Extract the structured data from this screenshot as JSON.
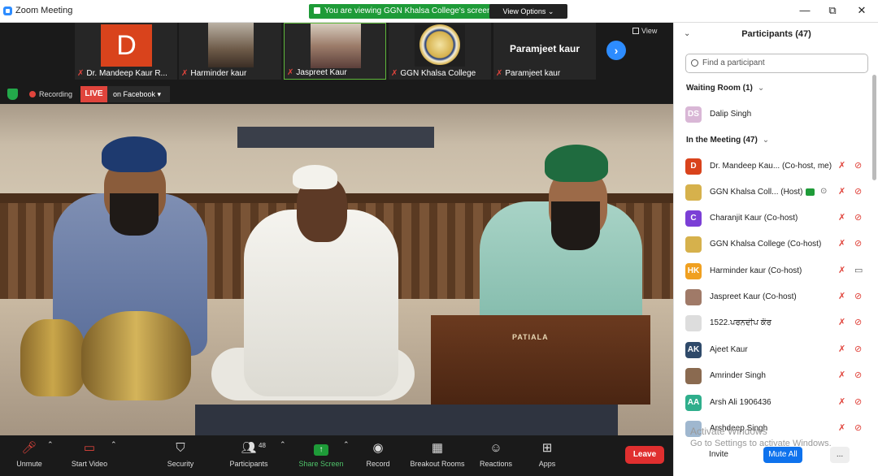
{
  "window": {
    "title": "Zoom Meeting",
    "minimize": "—",
    "maximize": "⧉",
    "close": "✕"
  },
  "banner": {
    "viewing_text": "You are viewing GGN Khalsa College's screen",
    "view_options": "View Options ⌄"
  },
  "thumbnails": [
    {
      "name": "Dr. Mandeep Kaur R...",
      "avatar_letter": "D"
    },
    {
      "name": "Harminder kaur"
    },
    {
      "name": "Jaspreet Kaur"
    },
    {
      "name": "GGN Khalsa College"
    },
    {
      "name": "Paramjeet kaur",
      "tile_name": "Paramjeet kaur"
    }
  ],
  "strip": {
    "next": "›",
    "view_label": "View"
  },
  "status": {
    "recording_label": "Recording",
    "live_label": "LIVE",
    "facebook_label": "on Facebook ▾"
  },
  "video": {
    "harmonium_brand": "PATIALA"
  },
  "toolbar": {
    "unmute": "Unmute",
    "start_video": "Start Video",
    "security": "Security",
    "participants": "Participants",
    "participants_count": "48",
    "share_screen": "Share Screen",
    "record": "Record",
    "breakout_rooms": "Breakout Rooms",
    "reactions": "Reactions",
    "apps": "Apps",
    "leave": "Leave"
  },
  "panel": {
    "title": "Participants (47)",
    "search_placeholder": "Find a participant",
    "waiting_room_label": "Waiting Room (1)",
    "in_meeting_label": "In the Meeting (47)",
    "waiting": [
      {
        "initials": "DS",
        "name": "Dalip Singh",
        "color": "#d9b7d6"
      }
    ],
    "participants": [
      {
        "initials": "D",
        "name": "Dr. Mandeep Kau... (Co-host, me)",
        "color": "#d9431c",
        "camera": "off"
      },
      {
        "initials": "",
        "name": "GGN Khalsa Coll... (Host)",
        "color": "#d6b14c",
        "camera": "off"
      },
      {
        "initials": "C",
        "name": "Charanjit Kaur (Co-host)",
        "color": "#7b3fd6",
        "camera": "off"
      },
      {
        "initials": "",
        "name": "GGN Khalsa College (Co-host)",
        "color": "#d6b14c",
        "camera": "off"
      },
      {
        "initials": "HK",
        "name": "Harminder kaur (Co-host)",
        "color": "#f0a020",
        "camera": "on"
      },
      {
        "initials": "",
        "name": "Jaspreet Kaur (Co-host)",
        "color": "#a07a68",
        "camera": "off"
      },
      {
        "initials": "",
        "name": "1522.ਪਰਨਦੀਪ ਕੌਰ",
        "color": "#dddddd",
        "camera": "off"
      },
      {
        "initials": "AK",
        "name": "Ajeet Kaur",
        "color": "#2f4a6a",
        "camera": "off"
      },
      {
        "initials": "",
        "name": "Amrinder Singh",
        "color": "#8a6a50",
        "camera": "off"
      },
      {
        "initials": "AA",
        "name": "Arsh Ali 1906436",
        "color": "#2fae8c",
        "camera": "off"
      },
      {
        "initials": "",
        "name": "Arshdeep Singh",
        "color": "#9fb7cf",
        "camera": "off"
      }
    ],
    "invite": "Invite",
    "mute_all": "Mute All",
    "more": "...",
    "watermark_1": "Activate Windows",
    "watermark_2": "Go to Settings to activate Windows."
  }
}
